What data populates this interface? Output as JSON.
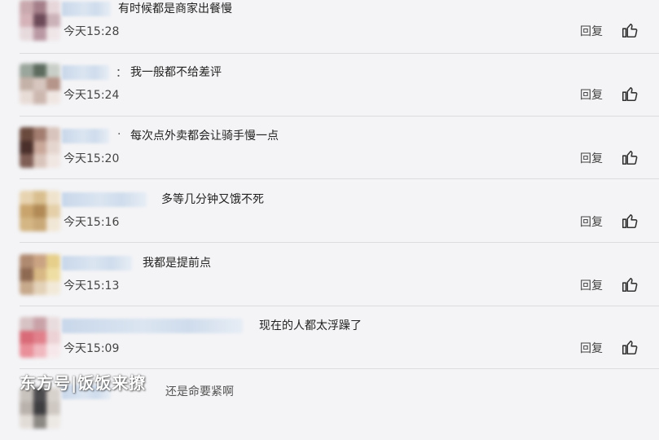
{
  "comments": [
    {
      "text": "有时候都是商家出餐慢",
      "time": "今天15:28",
      "reply": "回复",
      "colon": ""
    },
    {
      "text": "我一般都不给差评",
      "time": "今天15:24",
      "reply": "回复",
      "colon": "："
    },
    {
      "text": "每次点外卖都会让骑手慢一点",
      "time": "今天15:20",
      "reply": "回复",
      "colon": "·"
    },
    {
      "text": "多等几分钟又饿不死",
      "time": "今天15:16",
      "reply": "回复",
      "colon": ""
    },
    {
      "text": "我都是提前点",
      "time": "今天15:13",
      "reply": "回复",
      "colon": ""
    },
    {
      "text": "现在的人都太浮躁了",
      "time": "今天15:09",
      "reply": "回复",
      "colon": ""
    },
    {
      "text": "还是命要紧啊",
      "time": "",
      "reply": "",
      "colon": ""
    }
  ],
  "watermark": "东方号|饭饭来撩",
  "icons": {
    "like": "thumbs-up-icon"
  },
  "colors": {
    "background": "#f4f4f6",
    "divider": "#dcdcdf",
    "nickname_blur": "#cfdcec"
  }
}
